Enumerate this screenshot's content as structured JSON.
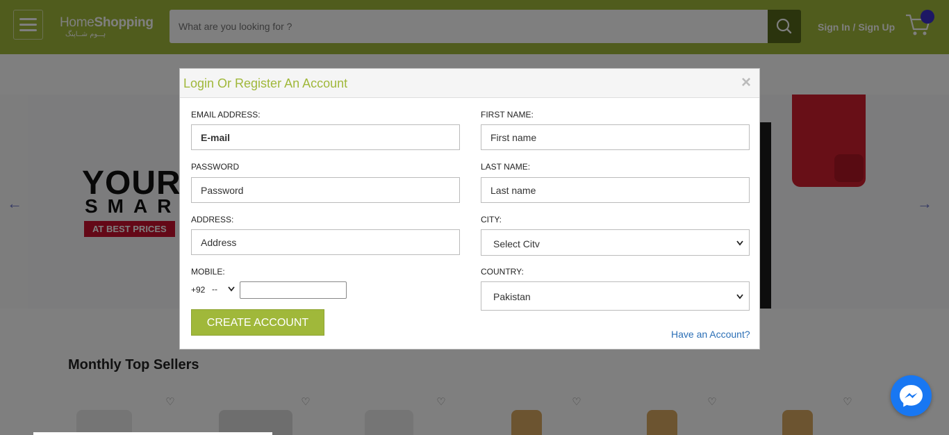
{
  "header": {
    "logo_main": "Home",
    "logo_bold": "Shopping",
    "logo_urdu": "ہــوم شــاپنگ",
    "search_placeholder": "What are you looking for ?",
    "signin_label": "Sign In / Sign Up"
  },
  "banner": {
    "title": "YOUR",
    "subtitle": "SMAR",
    "badge": "AT BEST PRICES"
  },
  "section": {
    "title": "Monthly Top Sellers"
  },
  "modal": {
    "title": "Login Or Register An Account",
    "close": "×",
    "email_label": "EMAIL ADDRESS:",
    "email_placeholder": "E-mail",
    "password_label": "PASSWORD",
    "password_placeholder": "Password",
    "address_label": "ADDRESS:",
    "address_placeholder": "Address",
    "mobile_label": "MOBILE:",
    "mobile_code": "+92",
    "mobile_prefix": "--",
    "first_name_label": "FIRST NAME:",
    "first_name_placeholder": "First name",
    "last_name_label": "LAST NAME:",
    "last_name_placeholder": "Last name",
    "city_label": "CITY:",
    "city_value": "Select Citv",
    "country_label": "COUNTRY:",
    "country_value": "Pakistan",
    "create_button": "CREATE ACCOUNT",
    "have_account": "Have an Account?"
  },
  "colors": {
    "brand_green": "#a0b83a",
    "search_button": "#56691b",
    "link_blue": "#2b6fb6",
    "messenger_blue": "#1877f2"
  }
}
